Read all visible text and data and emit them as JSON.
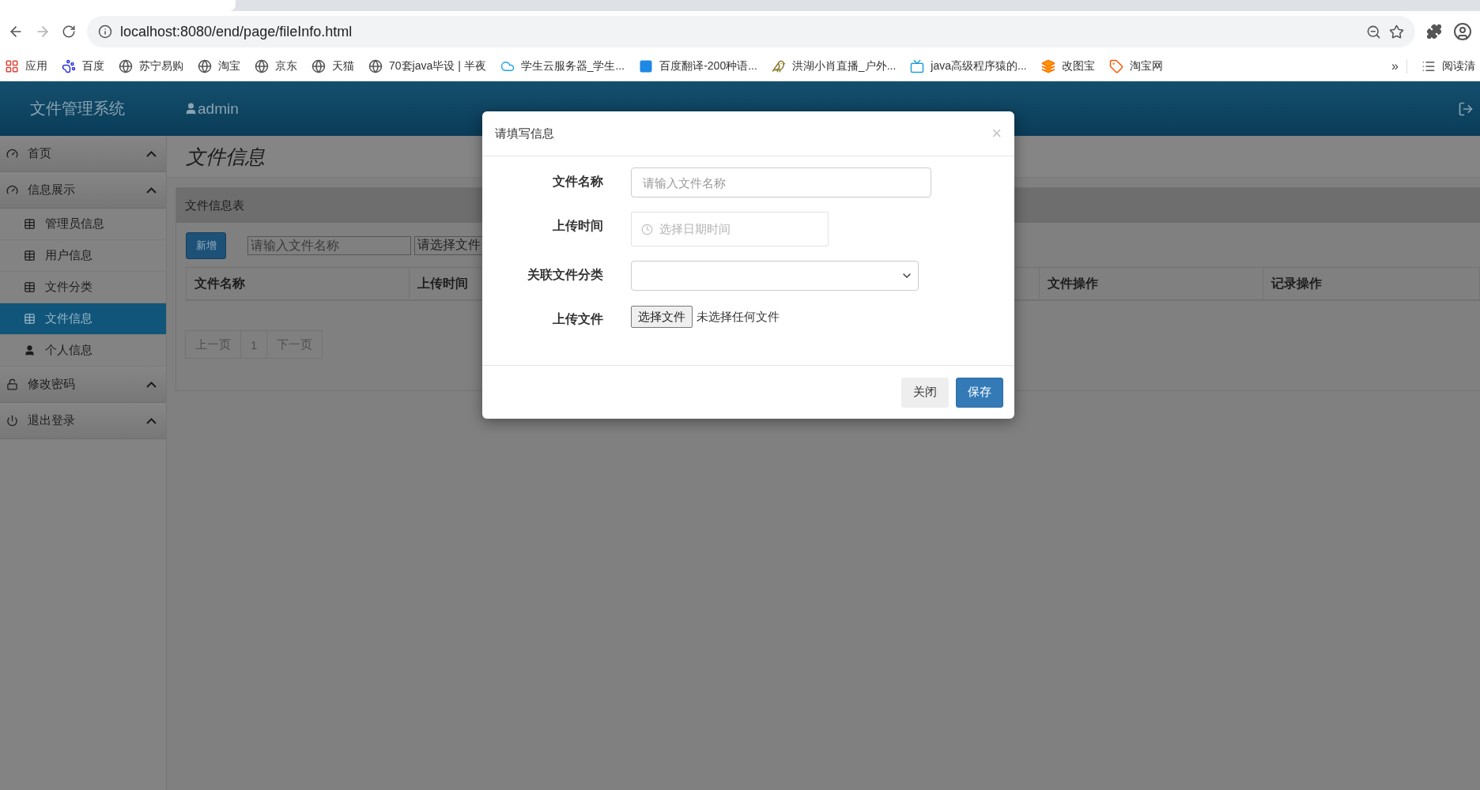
{
  "browser": {
    "url": "localhost:8080/end/page/fileInfo.html",
    "bookmarks": [
      {
        "label": "应用",
        "kind": "apps"
      },
      {
        "label": "百度",
        "kind": "paw"
      },
      {
        "label": "苏宁易购",
        "kind": "globe"
      },
      {
        "label": "淘宝",
        "kind": "globe"
      },
      {
        "label": "京东",
        "kind": "globe"
      },
      {
        "label": "天猫",
        "kind": "globe"
      },
      {
        "label": "70套java毕设 | 半夜",
        "kind": "globe"
      },
      {
        "label": "学生云服务器_学生...",
        "kind": "cloud"
      },
      {
        "label": "百度翻译-200种语...",
        "kind": "square"
      },
      {
        "label": "洪湖小肖直播_户外...",
        "kind": "bird"
      },
      {
        "label": "java高级程序猿的...",
        "kind": "tv"
      },
      {
        "label": "改图宝",
        "kind": "stack"
      },
      {
        "label": "淘宝网",
        "kind": "tag"
      }
    ],
    "overflow": "»",
    "reading_list": "阅读清"
  },
  "header": {
    "brand": "文件管理系统",
    "user": "admin"
  },
  "sidebar": {
    "items": [
      {
        "label": "首页",
        "kind": "home"
      },
      {
        "label": "信息展示",
        "kind": "home",
        "children": [
          {
            "label": "管理员信息",
            "kind": "table",
            "selected": false
          },
          {
            "label": "用户信息",
            "kind": "table",
            "selected": false
          },
          {
            "label": "文件分类",
            "kind": "table",
            "selected": false
          },
          {
            "label": "文件信息",
            "kind": "table",
            "selected": true
          },
          {
            "label": "个人信息",
            "kind": "user",
            "selected": false
          }
        ]
      },
      {
        "label": "修改密码",
        "kind": "lock"
      },
      {
        "label": "退出登录",
        "kind": "power"
      }
    ]
  },
  "page": {
    "title": "文件信息",
    "panel_title": "文件信息表",
    "add_button": "新增",
    "search_placeholder": "请输入文件名称",
    "category_select": "请选择文件",
    "columns": [
      "文件名称",
      "上传时间",
      "文件操作",
      "记录操作"
    ],
    "pagination": [
      "上一页",
      "1",
      "下一页"
    ]
  },
  "dialog": {
    "title": "请填写信息",
    "close": "×",
    "fields": [
      {
        "label": "文件名称",
        "kind": "text",
        "placeholder": "请输入文件名称"
      },
      {
        "label": "上传时间",
        "kind": "date",
        "placeholder": "选择日期时间"
      },
      {
        "label": "关联文件分类",
        "kind": "select"
      },
      {
        "label": "上传文件",
        "kind": "file",
        "button": "选择文件",
        "status": "未选择任何文件"
      }
    ],
    "buttons": [
      {
        "label": "关闭",
        "kind": "secondary"
      },
      {
        "label": "保存",
        "kind": "primary"
      }
    ]
  }
}
